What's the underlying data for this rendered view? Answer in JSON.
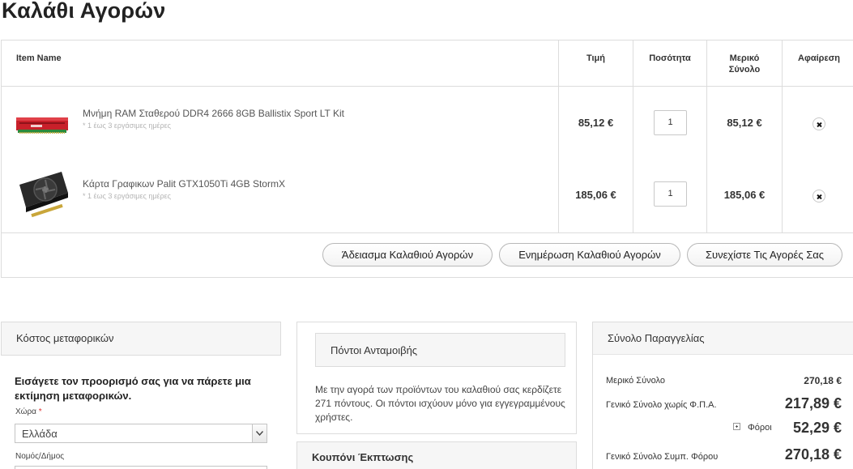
{
  "page": {
    "title": "Καλάθι Αγορών"
  },
  "cart": {
    "headers": {
      "item_name": "Item Name",
      "price": "Τιμή",
      "quantity": "Ποσότητα",
      "subtotal_line1": "Μερικό",
      "subtotal_line2": "Σύνολο",
      "remove": "Αφαίρεση"
    },
    "items": [
      {
        "name": "Μνήμη RAM Σταθερού DDR4 2666 8GB Ballistix Sport LT Kit",
        "note": "* 1 έως 3 εργάσιμες ημέρες",
        "price": "85,12 €",
        "qty": "1",
        "subtotal": "85,12 €",
        "thumb_icon": "ram-module-icon"
      },
      {
        "name": "Κάρτα Γραφικων Palit GTX1050Ti 4GB StormX",
        "note": "* 1 έως 3 εργάσιμες ημέρες",
        "price": "185,06 €",
        "qty": "1",
        "subtotal": "185,06 €",
        "thumb_icon": "graphics-card-icon"
      }
    ],
    "buttons": {
      "empty": "Άδειασμα Καλαθιού Αγορών",
      "update": "Ενημέρωση Καλαθιού Αγορών",
      "continue": "Συνεχίστε Τις Αγορές Σας"
    }
  },
  "shipping": {
    "title": "Κόστος μεταφορικών",
    "instructions": "Εισάγετε τον προορισμό σας για να πάρετε μια εκτίμηση μεταφορικών.",
    "country_label": "Χώρα",
    "required_mark": "*",
    "country_value": "Ελλάδα",
    "region_label": "Νομός/Δήμος"
  },
  "rewards": {
    "title": "Πόντοι Ανταμοιβής",
    "text": "Με την αγορά των προϊόντων του καλαθιού σας κερδίζετε 271 πόντους. Οι πόντοι ισχύουν μόνο για εγγεγραμμένους χρήστες."
  },
  "coupon": {
    "title": "Κουπόνι Έκπτωσης"
  },
  "totals": {
    "title": "Σύνολο Παραγγελίας",
    "rows": [
      {
        "label": "Μερικό Σύνολο",
        "value": "270,18 €"
      },
      {
        "label": "Γενικό Σύνολο χωρίς Φ.Π.Α.",
        "value": "217,89 €"
      },
      {
        "label": "Φόροι",
        "value": "52,29 €"
      },
      {
        "label": "Γενικό Σύνολο Συμπ. Φόρου",
        "value": "270,18 €"
      }
    ]
  },
  "colors": {
    "border": "#dcdcdc",
    "panel_header_bg": "#f6f6f6",
    "text": "#333333",
    "ram_red": "#c8202a"
  }
}
